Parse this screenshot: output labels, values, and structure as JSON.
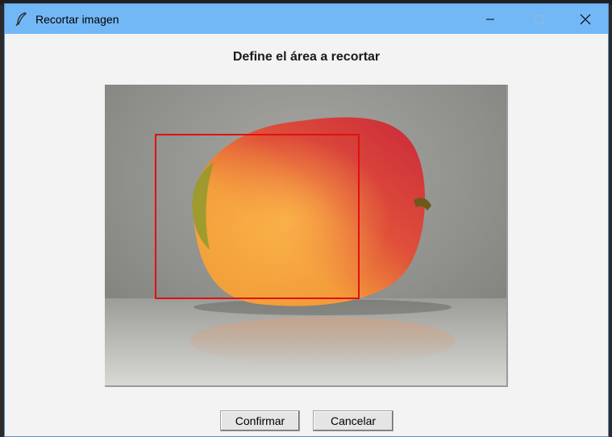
{
  "window": {
    "title": "Recortar imagen",
    "titlebar_color": "#73b8f6",
    "controls": {
      "minimize": "minimize-icon",
      "maximize": "maximize-icon",
      "close": "close-icon"
    }
  },
  "dialog": {
    "heading": "Define el área a recortar",
    "image_subject": "mango",
    "crop_rect_color": "#e01010",
    "buttons": {
      "confirm": "Confirmar",
      "cancel": "Cancelar"
    }
  }
}
